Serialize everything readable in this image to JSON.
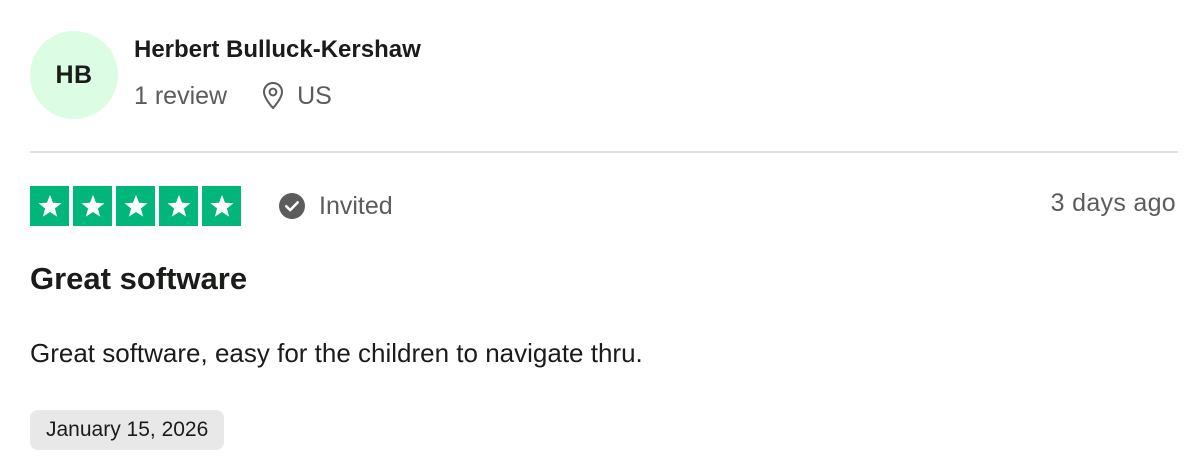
{
  "reviewer": {
    "initials": "HB",
    "name": "Herbert Bulluck-Kershaw",
    "review_count": "1 review",
    "location": "US",
    "avatar_color": "#dcfce4"
  },
  "rating": {
    "stars": 5,
    "max_stars": 5,
    "star_color": "#00b67a",
    "verified_label": "Invited",
    "posted": "3 days ago"
  },
  "review": {
    "title": "Great software",
    "body": "Great software, easy for the children to navigate thru.",
    "experience_date": "January 15, 2026"
  },
  "icons": {
    "location": "location-pin-icon",
    "verified": "check-circle-icon",
    "star": "star-icon"
  }
}
